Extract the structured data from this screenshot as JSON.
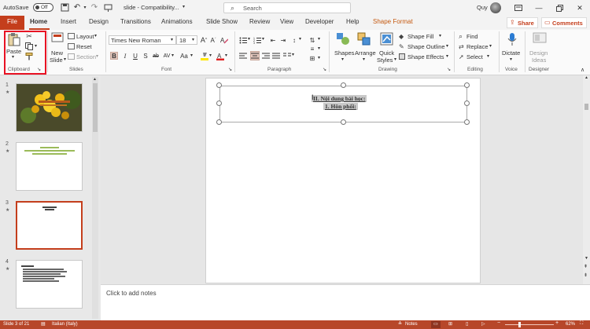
{
  "titlebar": {
    "autosave_label": "AutoSave",
    "autosave_state": "Off",
    "document_title": "slide  -  Compatibility...",
    "search_placeholder": "Search",
    "user_name": "Quy"
  },
  "tabs": [
    "File",
    "Home",
    "Insert",
    "Design",
    "Transitions",
    "Animations",
    "Slide Show",
    "Review",
    "View",
    "Developer",
    "Help",
    "Shape Format"
  ],
  "share_label": "Share",
  "comments_label": "Comments",
  "ribbon": {
    "clipboard": {
      "paste": "Paste",
      "group": "Clipboard"
    },
    "slides": {
      "new_slide_1": "New",
      "new_slide_2": "Slide",
      "layout": "Layout",
      "reset": "Reset",
      "section": "Section",
      "group": "Slides"
    },
    "font": {
      "name": "Times New Roman",
      "size": "18",
      "group": "Font"
    },
    "paragraph": {
      "group": "Paragraph"
    },
    "drawing": {
      "shapes": "Shapes",
      "arrange": "Arrange",
      "quick_styles_1": "Quick",
      "quick_styles_2": "Styles",
      "shape_fill": "Shape Fill",
      "shape_outline": "Shape Outline",
      "shape_effects": "Shape Effects",
      "group": "Drawing"
    },
    "editing": {
      "find": "Find",
      "replace": "Replace",
      "select": "Select",
      "group": "Editing"
    },
    "voice": {
      "dictate": "Dictate",
      "group": "Voice"
    },
    "designer": {
      "design_ideas_1": "Design",
      "design_ideas_2": "Ideas",
      "group": "Designer"
    }
  },
  "slides": [
    {
      "number": "1",
      "text": ""
    },
    {
      "number": "2",
      "text": ""
    },
    {
      "number": "3",
      "text": ""
    },
    {
      "number": "4",
      "text": ""
    }
  ],
  "slide": {
    "line1": "II. Nội dung bài học:",
    "line2": "1. Hôn phối:"
  },
  "notes_placeholder": "Click to add notes",
  "status": {
    "slide_of": "Slide 3 of 21",
    "language": "Italian (Italy)",
    "notes": "Notes",
    "zoom": "62%"
  },
  "colors": {
    "accent": "#b7472a",
    "highlight_box": "#e81123",
    "shape_format_tab": "#c55a11"
  }
}
